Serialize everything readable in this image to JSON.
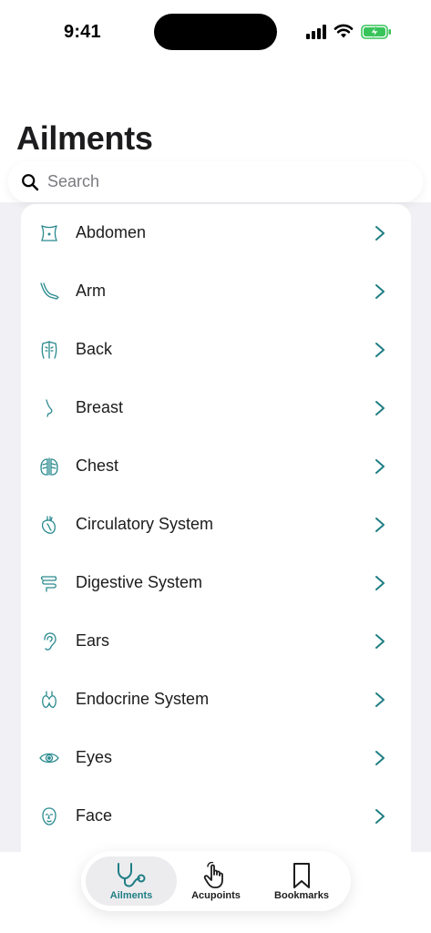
{
  "status_bar": {
    "time": "9:41"
  },
  "page": {
    "title": "Ailments"
  },
  "search": {
    "placeholder": "Search",
    "value": ""
  },
  "ailments": [
    {
      "label": "Abdomen",
      "icon": "abdomen-icon"
    },
    {
      "label": "Arm",
      "icon": "arm-icon"
    },
    {
      "label": "Back",
      "icon": "back-icon"
    },
    {
      "label": "Breast",
      "icon": "breast-icon"
    },
    {
      "label": "Chest",
      "icon": "chest-icon"
    },
    {
      "label": "Circulatory System",
      "icon": "heart-icon"
    },
    {
      "label": "Digestive System",
      "icon": "intestine-icon"
    },
    {
      "label": "Ears",
      "icon": "ear-icon"
    },
    {
      "label": "Endocrine System",
      "icon": "thyroid-icon"
    },
    {
      "label": "Eyes",
      "icon": "eye-icon"
    },
    {
      "label": "Face",
      "icon": "face-icon"
    }
  ],
  "tab_bar": {
    "tabs": [
      {
        "label": "Ailments",
        "icon": "stethoscope-icon",
        "active": true
      },
      {
        "label": "Acupoints",
        "icon": "hand-pointer-icon",
        "active": false
      },
      {
        "label": "Bookmarks",
        "icon": "bookmark-icon",
        "active": false
      }
    ]
  },
  "colors": {
    "accent": "#1f7e84",
    "icon_teal": "#2a8a8f",
    "text": "#1c1c1e",
    "background": "#f1f1f5"
  }
}
